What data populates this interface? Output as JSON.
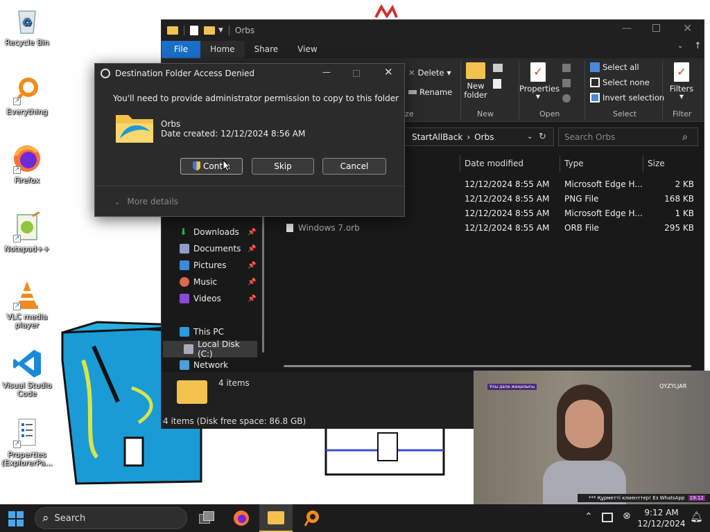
{
  "desktop": {
    "icons": [
      {
        "label": "Recycle Bin",
        "icon": "recycle-bin-icon",
        "shortcut": false
      },
      {
        "label": "Everything",
        "icon": "everything-search-icon",
        "shortcut": true
      },
      {
        "label": "Firefox",
        "icon": "firefox-icon",
        "shortcut": true
      },
      {
        "label": "Notepad++",
        "icon": "notepad-plus-plus-icon",
        "shortcut": true
      },
      {
        "label": "VLC media player",
        "icon": "vlc-icon",
        "shortcut": true
      },
      {
        "label": "Visual Studio Code",
        "icon": "vscode-icon",
        "shortcut": true
      },
      {
        "label": "Properties (ExplorerPa...",
        "icon": "properties-icon",
        "shortcut": true
      }
    ]
  },
  "explorer": {
    "title": "Orbs",
    "tabs": {
      "file": "File",
      "home": "Home",
      "share": "Share",
      "view": "View"
    },
    "ribbon": {
      "delete": "Delete",
      "rename": "Rename",
      "organize_label": "ize",
      "new_folder_line1": "New",
      "new_folder_line2": "folder",
      "new_label": "New",
      "properties": "Properties",
      "open_label": "Open",
      "select_all": "Select all",
      "select_none": "Select none",
      "invert_selection": "Invert selection",
      "select_label": "Select",
      "filters": "Filters",
      "filter_label": "Filter"
    },
    "address": {
      "segment1": "StartAllBack",
      "segment2": "Orbs"
    },
    "search_placeholder": "Search Orbs",
    "columns": {
      "date": "Date modified",
      "type": "Type",
      "size": "Size"
    },
    "files": [
      {
        "name": "",
        "date": "12/12/2024 8:55 AM",
        "type": "Microsoft Edge H...",
        "size": "2 KB"
      },
      {
        "name": "",
        "date": "12/12/2024 8:55 AM",
        "type": "PNG File",
        "size": "168 KB"
      },
      {
        "name": "",
        "date": "12/12/2024 8:55 AM",
        "type": "Microsoft Edge H...",
        "size": "1 KB"
      },
      {
        "name": "Windows 7.orb",
        "date": "12/12/2024 8:55 AM",
        "type": "ORB File",
        "size": "295 KB"
      }
    ],
    "nav": {
      "downloads": "Downloads",
      "documents": "Documents",
      "pictures": "Pictures",
      "music": "Music",
      "videos": "Videos",
      "this_pc": "This PC",
      "local_disk": "Local Disk (C:)",
      "network": "Network"
    },
    "details_count": "4 items",
    "status": "4 items (Disk free space: 86.8 GB)"
  },
  "dialog": {
    "title": "Destination Folder Access Denied",
    "message": "You'll need to provide administrator permission to copy to this folder",
    "folder_name": "Orbs",
    "date_created": "Date created: 12/12/2024 8:56 AM",
    "continue": "Contin",
    "skip": "Skip",
    "cancel": "Cancel",
    "more_details": "More details"
  },
  "video": {
    "tag_left": "Ұлы дала жаңалығы",
    "tag_right": "QYZYLJAR",
    "ticker": "*** Құрметті клиенттер! Ез WhatsApp",
    "ticker_time": "19:12"
  },
  "taskbar": {
    "search_label": "Search",
    "time": "9:12 AM",
    "date": "12/12/2024"
  },
  "colors": {
    "accent": "#1a6fc9",
    "dark_bg": "#191919",
    "ribbon_bg": "#2b2b2b",
    "folder_yellow": "#f2c14e"
  }
}
